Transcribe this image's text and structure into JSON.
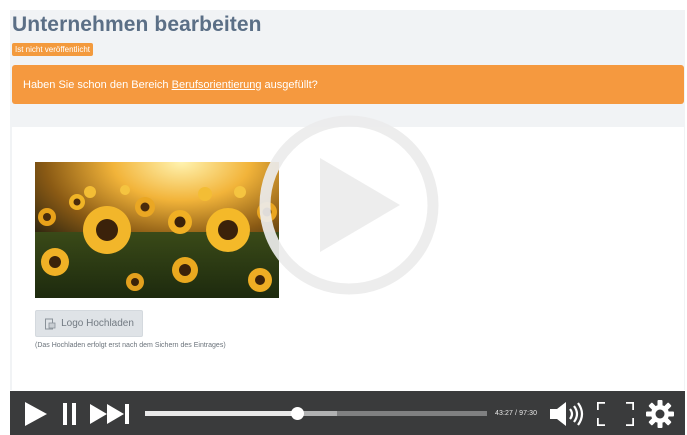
{
  "page": {
    "title": "Unternehmen bearbeiten",
    "status_badge": "Ist nicht veröffentlicht"
  },
  "alert": {
    "text_before": "Haben Sie schon den Bereich ",
    "link_text": "Berufsorientierung",
    "text_after": " ausgefüllt?",
    "color": "#f5993f"
  },
  "logo": {
    "image_alt": "sunflower-field-photo",
    "upload_label": "Logo Hochladen",
    "upload_hint": "(Das Hochladen erfolgt erst nach dem Sichern des Eintrages)"
  },
  "player": {
    "time_display": "43:27 / 97:30",
    "progress_fraction": 0.4457,
    "buffer_fraction": 0.56,
    "icons": [
      "play-icon",
      "pause-icon",
      "skip-forward-icon",
      "volume-icon",
      "fullscreen-icon",
      "settings-icon",
      "big-play-icon"
    ]
  }
}
